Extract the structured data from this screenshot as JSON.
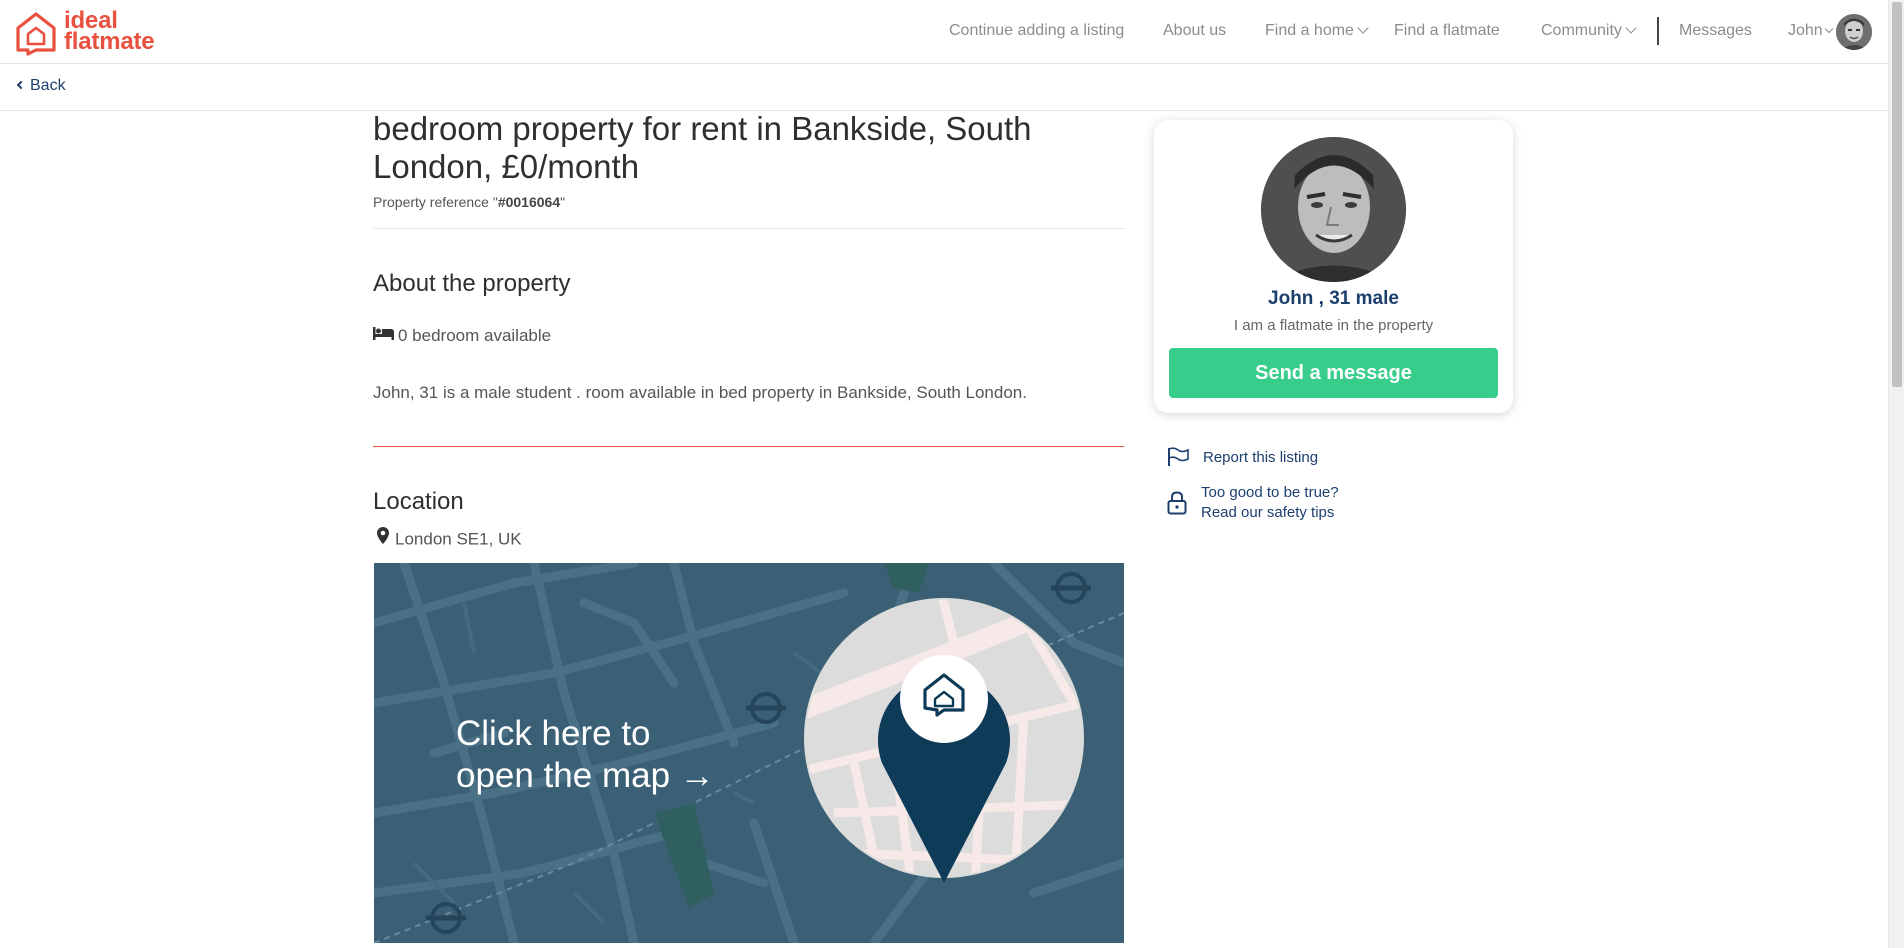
{
  "brand": {
    "logo_line1": "ideal",
    "logo_line2": "flatmate",
    "color": "#e8503f"
  },
  "nav": {
    "continue": "Continue adding a listing",
    "about": "About us",
    "find_home": "Find a home",
    "find_flatmate": "Find a flatmate",
    "community": "Community",
    "messages": "Messages",
    "user": "John"
  },
  "back": {
    "label": "Back"
  },
  "listing": {
    "title": "bedroom property for rent in Bankside, South London, £0/month",
    "ref_label": "Property reference \"",
    "ref_value": "#0016064",
    "ref_end": "\"",
    "about_heading": "About the property",
    "bedrooms": "0 bedroom available",
    "description": "John, 31 is a male student . room available in bed property in Bankside, South London.",
    "location_heading": "Location",
    "location": "London SE1, UK",
    "map_cta_line1": "Click here to",
    "map_cta_line2": "open the map →"
  },
  "profile": {
    "name": "John , 31 male",
    "subtitle": "I am a flatmate in the property",
    "send_button": "Send a message"
  },
  "side_links": {
    "report": "Report this listing",
    "safety_line1": "Too good to be true?",
    "safety_line2": "Read our safety tips"
  },
  "colors": {
    "accent": "#e8503f",
    "navy": "#1c3f6e",
    "button_green": "#38cd8a",
    "map_bg": "#3b6075"
  }
}
